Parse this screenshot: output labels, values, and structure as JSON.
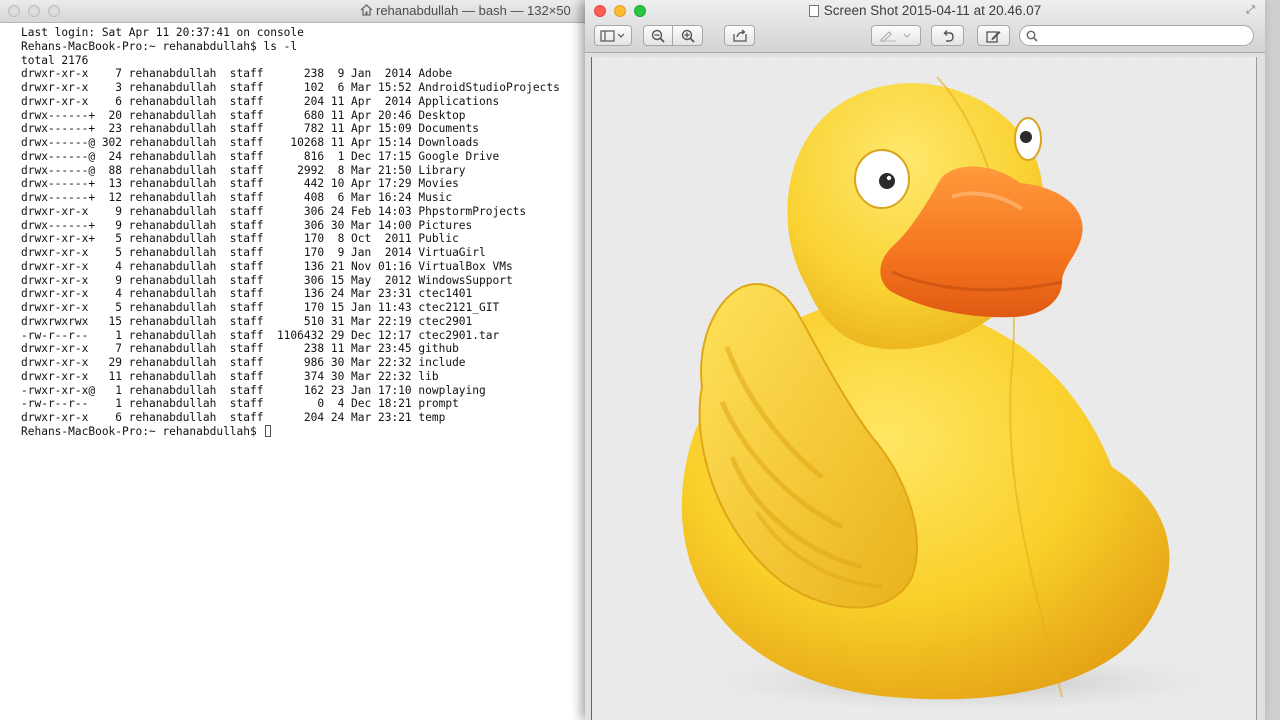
{
  "terminal": {
    "title": "rehanabdullah — bash — 132×50",
    "lines": [
      "Last login: Sat Apr 11 20:37:41 on console",
      "Rehans-MacBook-Pro:~ rehanabdullah$ ls -l",
      "total 2176",
      "drwxr-xr-x    7 rehanabdullah  staff      238  9 Jan  2014 Adobe",
      "drwxr-xr-x    3 rehanabdullah  staff      102  6 Mar 15:52 AndroidStudioProjects",
      "drwxr-xr-x    6 rehanabdullah  staff      204 11 Apr  2014 Applications",
      "drwx------+  20 rehanabdullah  staff      680 11 Apr 20:46 Desktop",
      "drwx------+  23 rehanabdullah  staff      782 11 Apr 15:09 Documents",
      "drwx------@ 302 rehanabdullah  staff    10268 11 Apr 15:14 Downloads",
      "drwx------@  24 rehanabdullah  staff      816  1 Dec 17:15 Google Drive",
      "drwx------@  88 rehanabdullah  staff     2992  8 Mar 21:50 Library",
      "drwx------+  13 rehanabdullah  staff      442 10 Apr 17:29 Movies",
      "drwx------+  12 rehanabdullah  staff      408  6 Mar 16:24 Music",
      "drwxr-xr-x    9 rehanabdullah  staff      306 24 Feb 14:03 PhpstormProjects",
      "drwx------+   9 rehanabdullah  staff      306 30 Mar 14:00 Pictures",
      "drwxr-xr-x+   5 rehanabdullah  staff      170  8 Oct  2011 Public",
      "drwxr-xr-x    5 rehanabdullah  staff      170  9 Jan  2014 VirtuaGirl",
      "drwxr-xr-x    4 rehanabdullah  staff      136 21 Nov 01:16 VirtualBox VMs",
      "drwxr-xr-x    9 rehanabdullah  staff      306 15 May  2012 WindowsSupport",
      "drwxr-xr-x    4 rehanabdullah  staff      136 24 Mar 23:31 ctec1401",
      "drwxr-xr-x    5 rehanabdullah  staff      170 15 Jan 11:43 ctec2121_GIT",
      "drwxrwxrwx   15 rehanabdullah  staff      510 31 Mar 22:19 ctec2901",
      "-rw-r--r--    1 rehanabdullah  staff  1106432 29 Dec 12:17 ctec2901.tar",
      "drwxr-xr-x    7 rehanabdullah  staff      238 11 Mar 23:45 github",
      "drwxr-xr-x   29 rehanabdullah  staff      986 30 Mar 22:32 include",
      "drwxr-xr-x   11 rehanabdullah  staff      374 30 Mar 22:32 lib",
      "-rwxr-xr-x@   1 rehanabdullah  staff      162 23 Jan 17:10 nowplaying",
      "-rw-r--r--    1 rehanabdullah  staff        0  4 Dec 18:21 prompt",
      "drwxr-xr-x    6 rehanabdullah  staff      204 24 Mar 23:21 temp"
    ],
    "prompt": "Rehans-MacBook-Pro:~ rehanabdullah$ "
  },
  "preview": {
    "title": "Screen Shot 2015-04-11 at 20.46.07",
    "search": {
      "value": "",
      "placeholder": ""
    },
    "image_subject": "cyberduck-logo"
  },
  "colors": {
    "close": "#fc5f57",
    "minimize": "#fdbc2e",
    "zoom": "#29c840",
    "duck_body": "#f7cf2c",
    "duck_beak": "#f47a2c"
  }
}
